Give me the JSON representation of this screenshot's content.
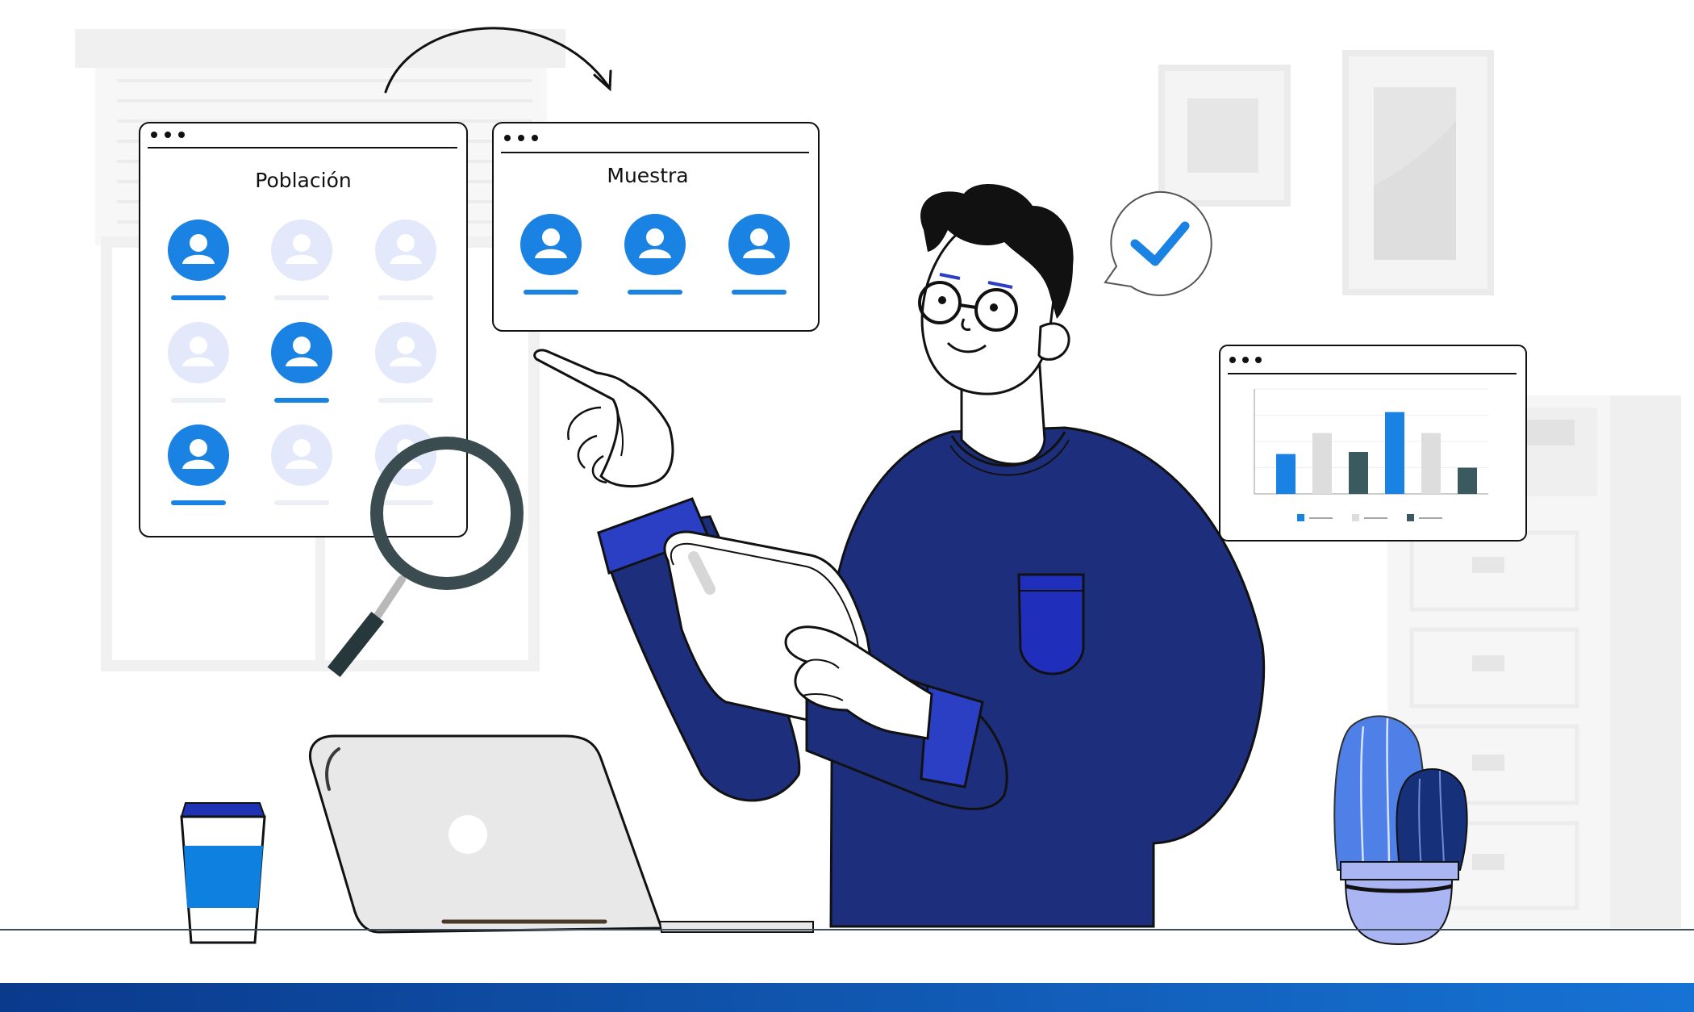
{
  "population_window": {
    "title": "Población",
    "people": [
      {
        "selected": true
      },
      {
        "selected": false
      },
      {
        "selected": false
      },
      {
        "selected": false
      },
      {
        "selected": true
      },
      {
        "selected": false
      },
      {
        "selected": true
      },
      {
        "selected": false
      },
      {
        "selected": false
      }
    ]
  },
  "sample_window": {
    "title": "Muestra",
    "people": [
      {
        "selected": true
      },
      {
        "selected": true
      },
      {
        "selected": true
      }
    ]
  },
  "chart_data": {
    "type": "bar",
    "categories": [
      "",
      "",
      "",
      "",
      "",
      ""
    ],
    "values": [
      0.38,
      0.58,
      0.4,
      0.78,
      0.58,
      0.25
    ],
    "bar_colors": [
      "#1a82e2",
      "#dddddd",
      "#3a5a60",
      "#1a82e2",
      "#dddddd",
      "#3a5a60"
    ],
    "legend_colors": [
      "#1a82e2",
      "#dddddd",
      "#3a5a60"
    ],
    "ylim": [
      0,
      1
    ],
    "grid": true
  },
  "colors": {
    "accent_blue": "#1a82e2",
    "faded_avatar": "#e3e8fb",
    "sweater": "#1d2f7c",
    "cuff": "#2b3fc4",
    "bottom_bar_start": "#0a3a8c",
    "bottom_bar_end": "#1673d4",
    "checkmark": "#1a82e2",
    "cactus_light": "#4f80e8",
    "cactus_dark": "#17307a",
    "pot": "#aab6f4"
  },
  "icons": {
    "checkmark_bubble": "check-icon",
    "magnifier": "magnifier-icon",
    "laptop_logo": "laptop-logo",
    "coffee_cup": "coffee-cup",
    "cactus": "cactus-plant",
    "arrow": "curved-arrow"
  }
}
